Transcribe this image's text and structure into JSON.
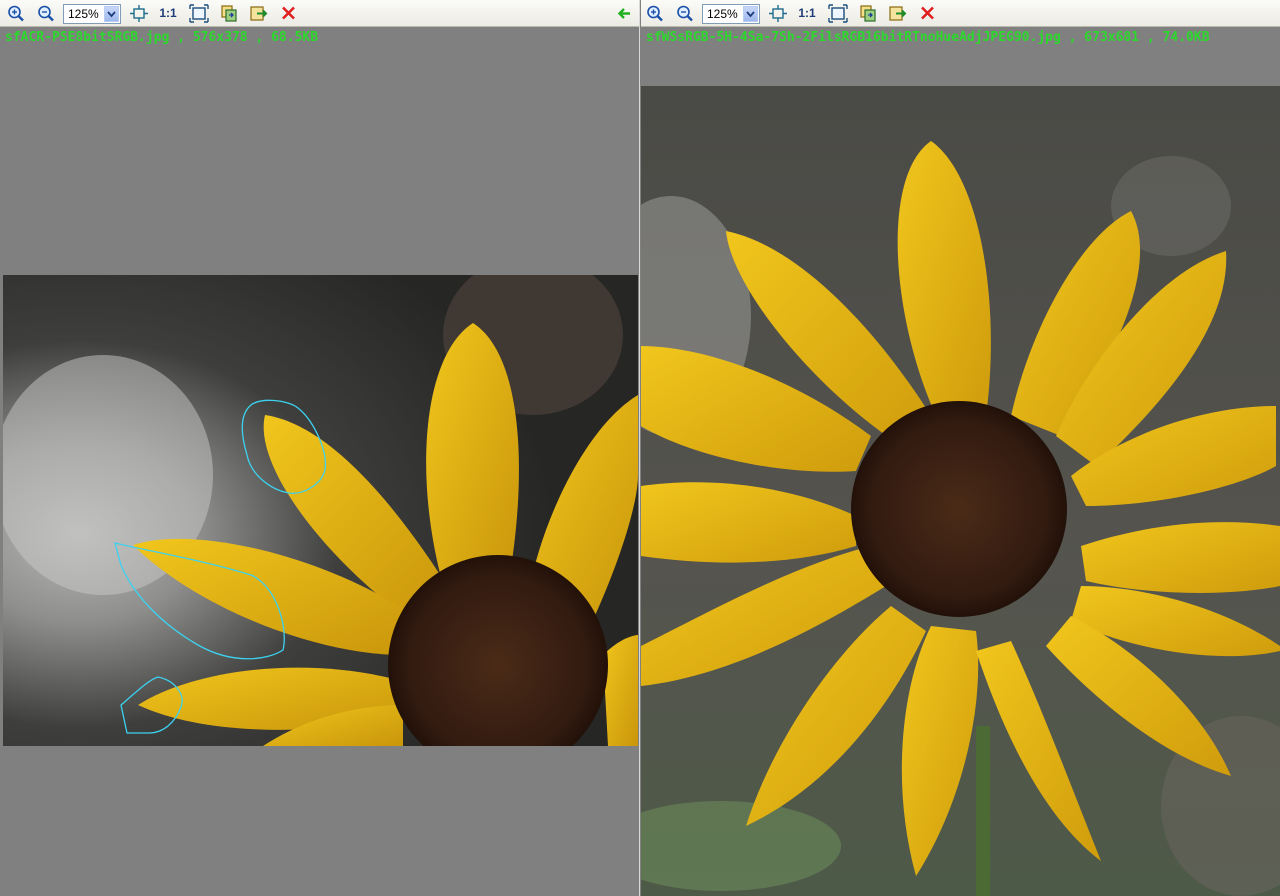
{
  "zoom_options": [
    "125%"
  ],
  "left": {
    "zoom_value": "125%",
    "actual_size_label": "1:1",
    "caption": "sfACR-PSE8bitSRGB.jpg , 576x378 , 68.5KB"
  },
  "right": {
    "zoom_value": "125%",
    "actual_size_label": "1:1",
    "caption": "sfWSsRGB-5H-4Sa-7Sh-2FilsRGB16bitRTnoHueAdjJPEG90.jpg , 673x681 , 74.0KB"
  },
  "colors": {
    "caption": "#2bd82b",
    "close": "#e02020",
    "sync_arrow": "#20b020",
    "annotation": "#3cd2f0",
    "petal": "#e3b20f",
    "center": "#3a1f14"
  },
  "icons": [
    "zoom-in-icon",
    "zoom-out-icon",
    "fit-icon",
    "fullscreen-icon",
    "copy-icon",
    "save-icon",
    "close-icon",
    "sync-arrow-icon"
  ]
}
